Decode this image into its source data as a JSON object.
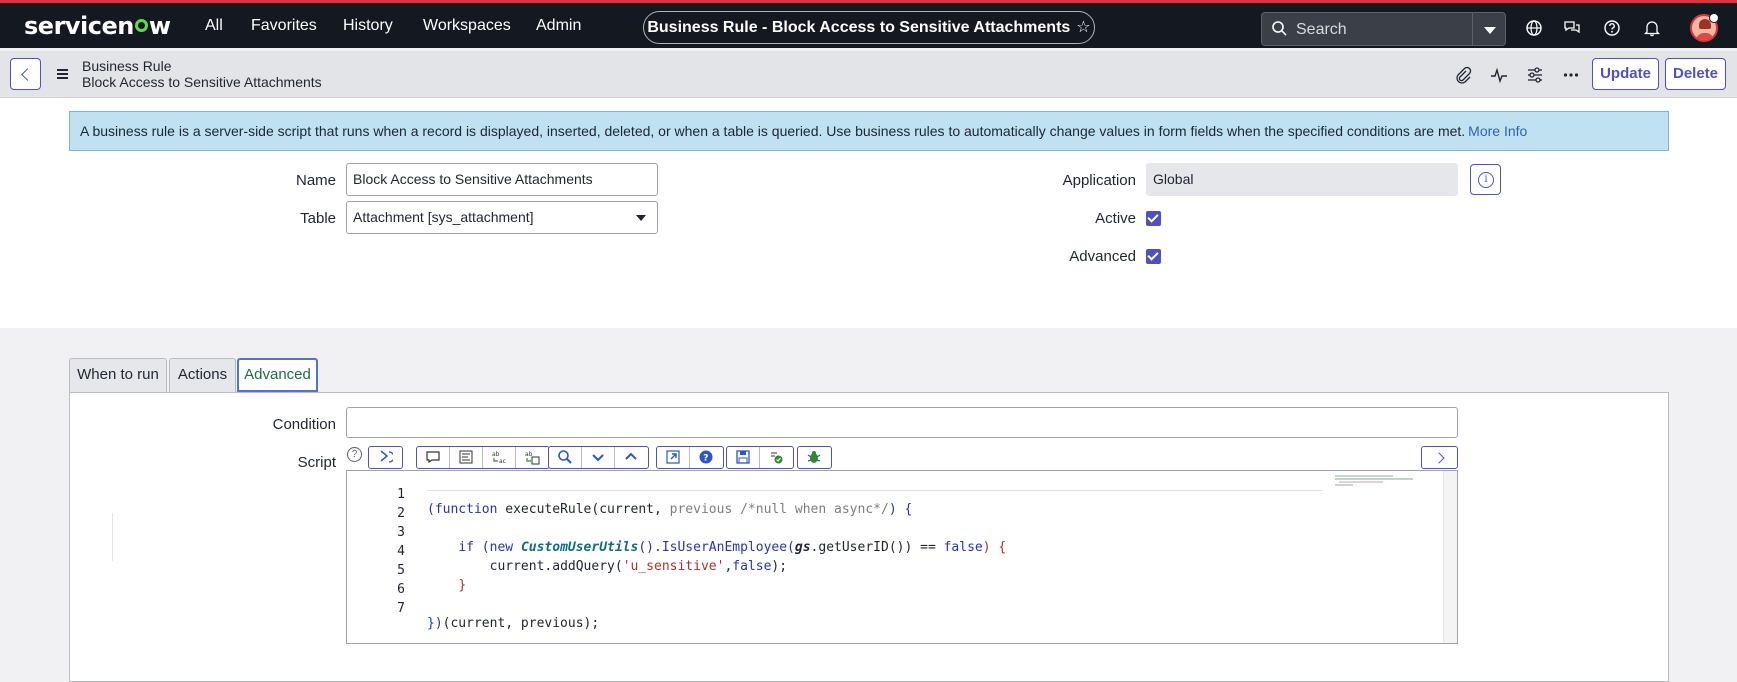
{
  "topnav": {
    "logo": "servicenow",
    "items": [
      "All",
      "Favorites",
      "History",
      "Workspaces",
      "Admin"
    ],
    "record_title": "Business Rule - Block Access to Sensitive Attachments",
    "favorite_glyph": "☆",
    "search_placeholder": "Search",
    "icons": [
      "globe-icon",
      "chat-icon",
      "help-icon",
      "bell-icon",
      "avatar"
    ]
  },
  "header": {
    "record_type": "Business Rule",
    "record_name": "Block Access to Sensitive Attachments",
    "icons": [
      "paperclip-icon",
      "activity-icon",
      "sliders-icon",
      "more-icon"
    ],
    "update_label": "Update",
    "delete_label": "Delete"
  },
  "banner": {
    "text": "A business rule is a server-side script that runs when a record is displayed, inserted, deleted, or when a table is queried. Use business rules to automatically change values in form fields when the specified conditions are met.",
    "link": "More Info"
  },
  "form": {
    "name_label": "Name",
    "name_value": "Block Access to Sensitive Attachments",
    "table_label": "Table",
    "table_value": "Attachment [sys_attachment]",
    "application_label": "Application",
    "application_value": "Global",
    "active_label": "Active",
    "active_checked": true,
    "advanced_label": "Advanced",
    "advanced_checked": true
  },
  "tabs": [
    {
      "label": "When to run",
      "active": false
    },
    {
      "label": "Actions",
      "active": false
    },
    {
      "label": "Advanced",
      "active": true
    }
  ],
  "advanced": {
    "condition_label": "Condition",
    "condition_value": "",
    "script_label": "Script",
    "help_glyph": "?",
    "line_numbers": [
      "1",
      "2",
      "3",
      "4",
      "5",
      "6",
      "7"
    ]
  },
  "colors": {
    "accent": "#4f52bd",
    "topbar": "#141820",
    "brand_red": "#e0323b",
    "banner_bg": "#bfe1f2"
  }
}
